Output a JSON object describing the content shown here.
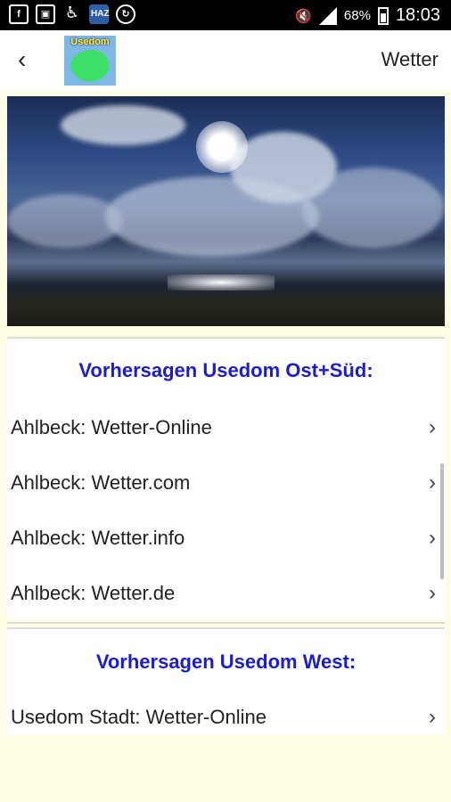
{
  "status_bar": {
    "battery": "68%",
    "time": "18:03",
    "icons": [
      "facebook-icon",
      "sim-icon",
      "accessibility-icon",
      "haz-app-icon",
      "sync-icon",
      "mute-icon",
      "signal-icon",
      "battery-icon"
    ],
    "haz_label": "HAZ"
  },
  "app_bar": {
    "title": "Wetter",
    "logo_text": "Usedom"
  },
  "sections": [
    {
      "title": "Vorhersagen Usedom Ost+Süd:",
      "items": [
        {
          "label": "Ahlbeck: Wetter-Online"
        },
        {
          "label": "Ahlbeck: Wetter.com"
        },
        {
          "label": "Ahlbeck: Wetter.info"
        },
        {
          "label": "Ahlbeck: Wetter.de"
        }
      ]
    },
    {
      "title": "Vorhersagen Usedom West:",
      "items": [
        {
          "label": "Usedom Stadt: Wetter-Online"
        }
      ]
    }
  ],
  "colors": {
    "background": "#fdfde3",
    "section_title": "#1c1ccc"
  }
}
